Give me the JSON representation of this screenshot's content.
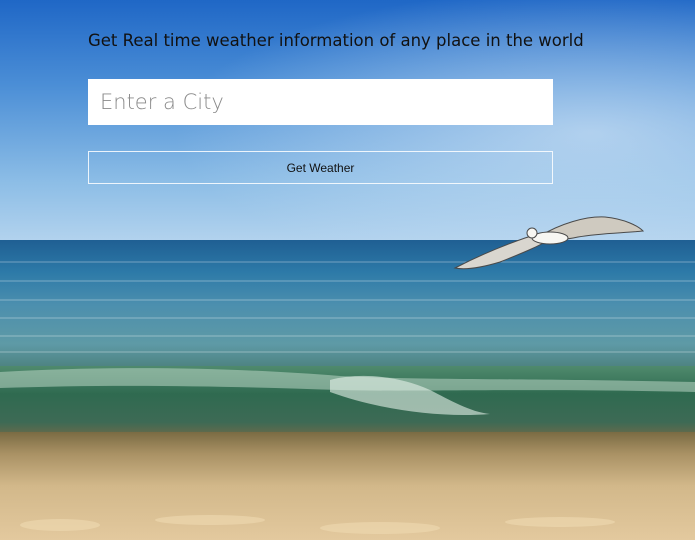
{
  "tagline": "Get Real time weather information of any place in the world",
  "search": {
    "placeholder": "Enter a City",
    "value": ""
  },
  "button": {
    "label": "Get Weather"
  }
}
